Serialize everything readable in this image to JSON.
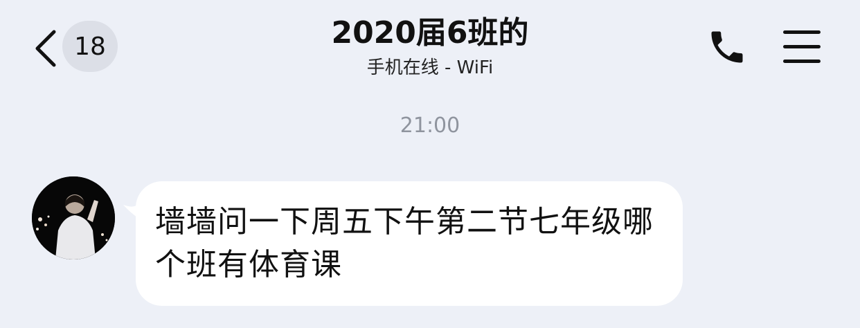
{
  "header": {
    "back_count": "18",
    "title": "2020届6班的",
    "subtitle": "手机在线 - WiFi"
  },
  "timestamp": "21:00",
  "messages": [
    {
      "sender": "other",
      "text": "墙墙问一下周五下午第二节七年级哪个班有体育课"
    }
  ],
  "icons": {
    "back": "chevron-left-icon",
    "call": "phone-icon",
    "menu": "hamburger-menu-icon"
  },
  "colors": {
    "background": "#edf0f7",
    "bubble": "#ffffff",
    "badge": "#dcdfe7",
    "timestamp": "#8f949e"
  }
}
